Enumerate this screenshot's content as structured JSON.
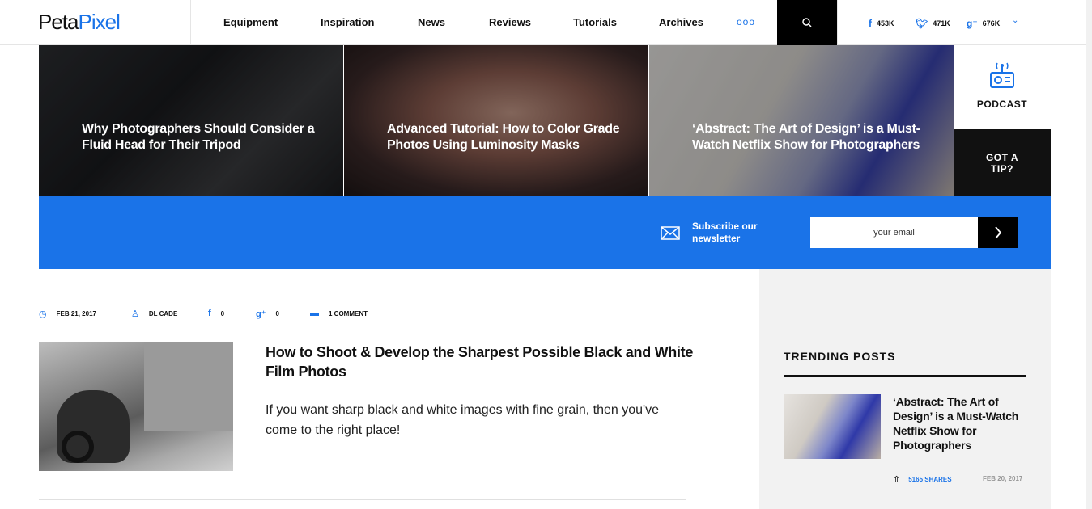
{
  "header": {
    "logo_part1": "Peta",
    "logo_part2": "Pixel",
    "nav": [
      "Equipment",
      "Inspiration",
      "News",
      "Reviews",
      "Tutorials",
      "Archives"
    ],
    "more": "ooo",
    "social": {
      "facebook": "453K",
      "twitter": "471K",
      "googleplus": "676K"
    }
  },
  "hero": [
    {
      "title": "Why Photographers Should Consider a Fluid Head for Their Tripod"
    },
    {
      "title": "Advanced Tutorial: How to Color Grade Photos Using Luminosity Masks"
    },
    {
      "title": "‘Abstract: The Art of Design’ is a Must-Watch Netflix Show for Photographers"
    }
  ],
  "podcast": {
    "label": "PODCAST"
  },
  "tip": {
    "label": "GOT A TIP?"
  },
  "newsletter": {
    "text": "Subscribe our newsletter",
    "placeholder": "your email"
  },
  "article": {
    "date": "FEB 21, 2017",
    "author": "DL CADE",
    "fb_count": "0",
    "gp_count": "0",
    "comments": "1 COMMENT",
    "title": "How to Shoot & Develop the Sharpest Possible Black and White Film Photos",
    "excerpt": "If you want sharp black and white images with fine grain, then you've come to the right place!"
  },
  "sidebar": {
    "heading": "TRENDING POSTS",
    "post": {
      "title": "‘Abstract: The Art of Design’ is a Must-Watch Netflix Show for Photographers",
      "shares": "5165 SHARES",
      "date": "FEB 20, 2017"
    }
  },
  "colors": {
    "accent": "#1a73e8",
    "dark": "#111111",
    "sidebar_bg": "#f2f2f2"
  }
}
